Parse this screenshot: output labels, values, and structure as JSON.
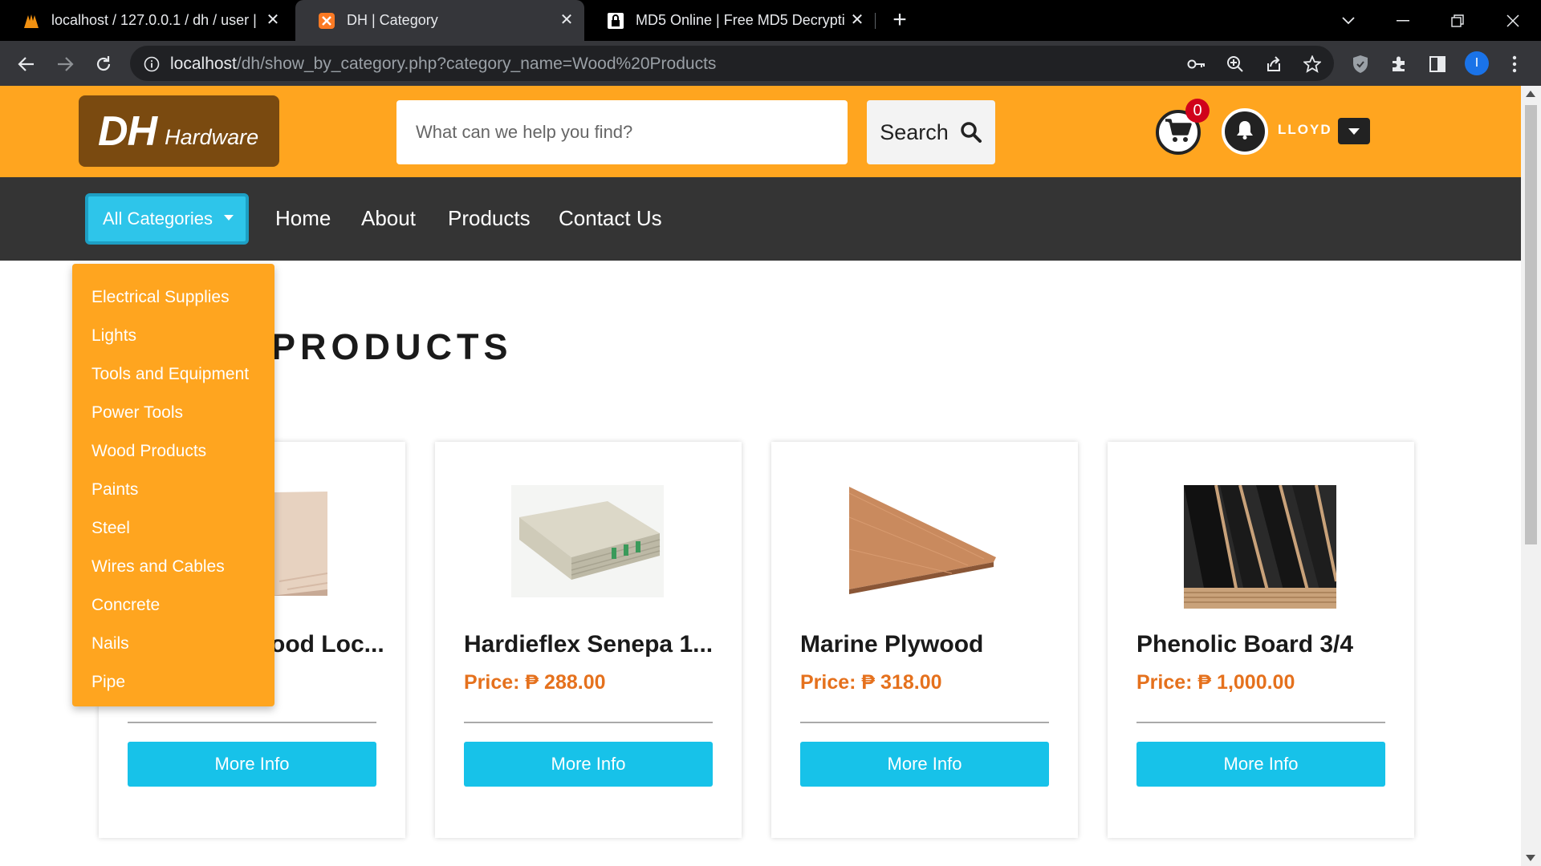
{
  "browser": {
    "tabs": [
      {
        "title": "localhost / 127.0.0.1 / dh / user |",
        "active": false,
        "icon": "phpmyadmin-icon"
      },
      {
        "title": "DH | Category",
        "active": true,
        "icon": "xampp-icon"
      },
      {
        "title": "MD5 Online | Free MD5 Decrypti",
        "active": false,
        "icon": "lock-icon"
      }
    ],
    "url": {
      "host": "localhost",
      "path": "/dh/show_by_category.php?category_name=Wood%20Products"
    },
    "profile_initial": "I"
  },
  "site": {
    "colors": {
      "header": "#ffa51f",
      "nav": "#343434",
      "accent": "#17c2e9",
      "price": "#e5711d"
    },
    "logo": {
      "main": "DH",
      "sub": "Hardware"
    },
    "search": {
      "placeholder": "What can we help you find?",
      "button_label": "Search"
    },
    "cart_count": "0",
    "user_name": "LLOYD",
    "nav": {
      "categories_label": "All Categories",
      "links": [
        "Home",
        "About",
        "Products",
        "Contact Us"
      ]
    },
    "dropdown": [
      "Electrical Supplies",
      "Lights",
      "Tools and Equipment",
      "Power Tools",
      "Wood Products",
      "Paints",
      "Steel",
      "Wires and Cables",
      "Concrete",
      "Nails",
      "Pipe"
    ],
    "section_title_visible": "PRODUCTS",
    "products": [
      {
        "name": "ood Loc...",
        "price": "",
        "button": "More Info"
      },
      {
        "name": "Hardieflex Senepa 1...",
        "price": "Price: ₱ 288.00",
        "button": "More Info"
      },
      {
        "name": "Marine Plywood",
        "price": "Price: ₱ 318.00",
        "button": "More Info"
      },
      {
        "name": "Phenolic Board 3/4",
        "price": "Price: ₱ 1,000.00",
        "button": "More Info"
      }
    ]
  }
}
